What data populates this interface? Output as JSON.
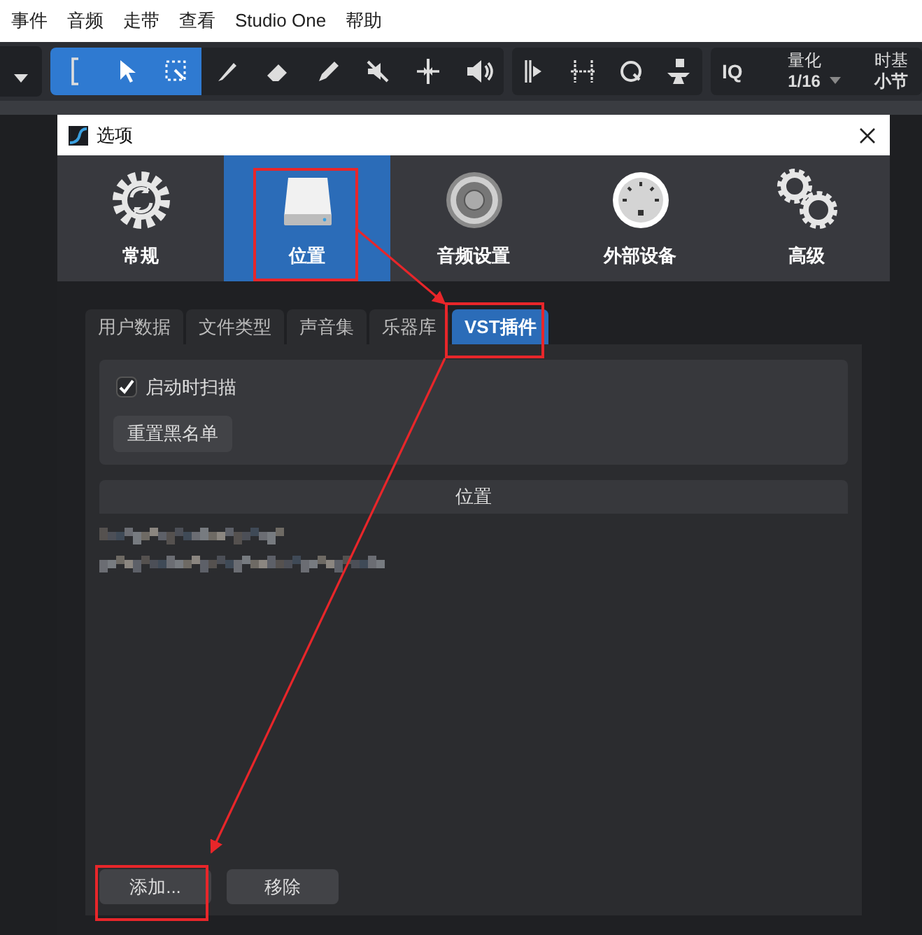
{
  "menu": [
    "事件",
    "音频",
    "走带",
    "查看",
    "Studio One",
    "帮助"
  ],
  "toolbar": {
    "tools": [
      {
        "kind": "range",
        "selected": true
      },
      {
        "kind": "arrow",
        "selected": true
      },
      {
        "kind": "select",
        "selected": true
      },
      {
        "kind": "knife",
        "selected": false
      },
      {
        "kind": "eraser",
        "selected": false
      },
      {
        "kind": "pen",
        "selected": false
      },
      {
        "kind": "mute",
        "selected": false
      },
      {
        "kind": "split",
        "selected": false
      },
      {
        "kind": "listen",
        "selected": false
      }
    ],
    "snap_tools": [
      {
        "kind": "bar-snap"
      },
      {
        "kind": "grid-snap"
      },
      {
        "kind": "quantize"
      },
      {
        "kind": "paint"
      }
    ],
    "iq": "IQ",
    "quantize": {
      "label": "量化",
      "value": "1/16"
    },
    "timebase": {
      "label": "时基",
      "value": "小节"
    }
  },
  "dialog": {
    "title": "选项",
    "categories": [
      {
        "label": "常规",
        "kind": "general",
        "selected": false
      },
      {
        "label": "位置",
        "kind": "location",
        "selected": true
      },
      {
        "label": "音频设置",
        "kind": "audio",
        "selected": false
      },
      {
        "label": "外部设备",
        "kind": "external",
        "selected": false
      },
      {
        "label": "高级",
        "kind": "advanced",
        "selected": false
      }
    ],
    "tabs": [
      {
        "label": "用户数据",
        "selected": false
      },
      {
        "label": "文件类型",
        "selected": false
      },
      {
        "label": "声音集",
        "selected": false
      },
      {
        "label": "乐器库",
        "selected": false
      },
      {
        "label": "VST插件",
        "selected": true
      }
    ],
    "scan_checkbox": {
      "label": "启动时扫描",
      "checked": true
    },
    "reset_button": "重置黑名单",
    "locations": {
      "header": "位置",
      "rows": [
        {
          "kind": "redacted"
        },
        {
          "kind": "redacted"
        }
      ]
    },
    "buttons": [
      "添加...",
      "移除"
    ]
  }
}
